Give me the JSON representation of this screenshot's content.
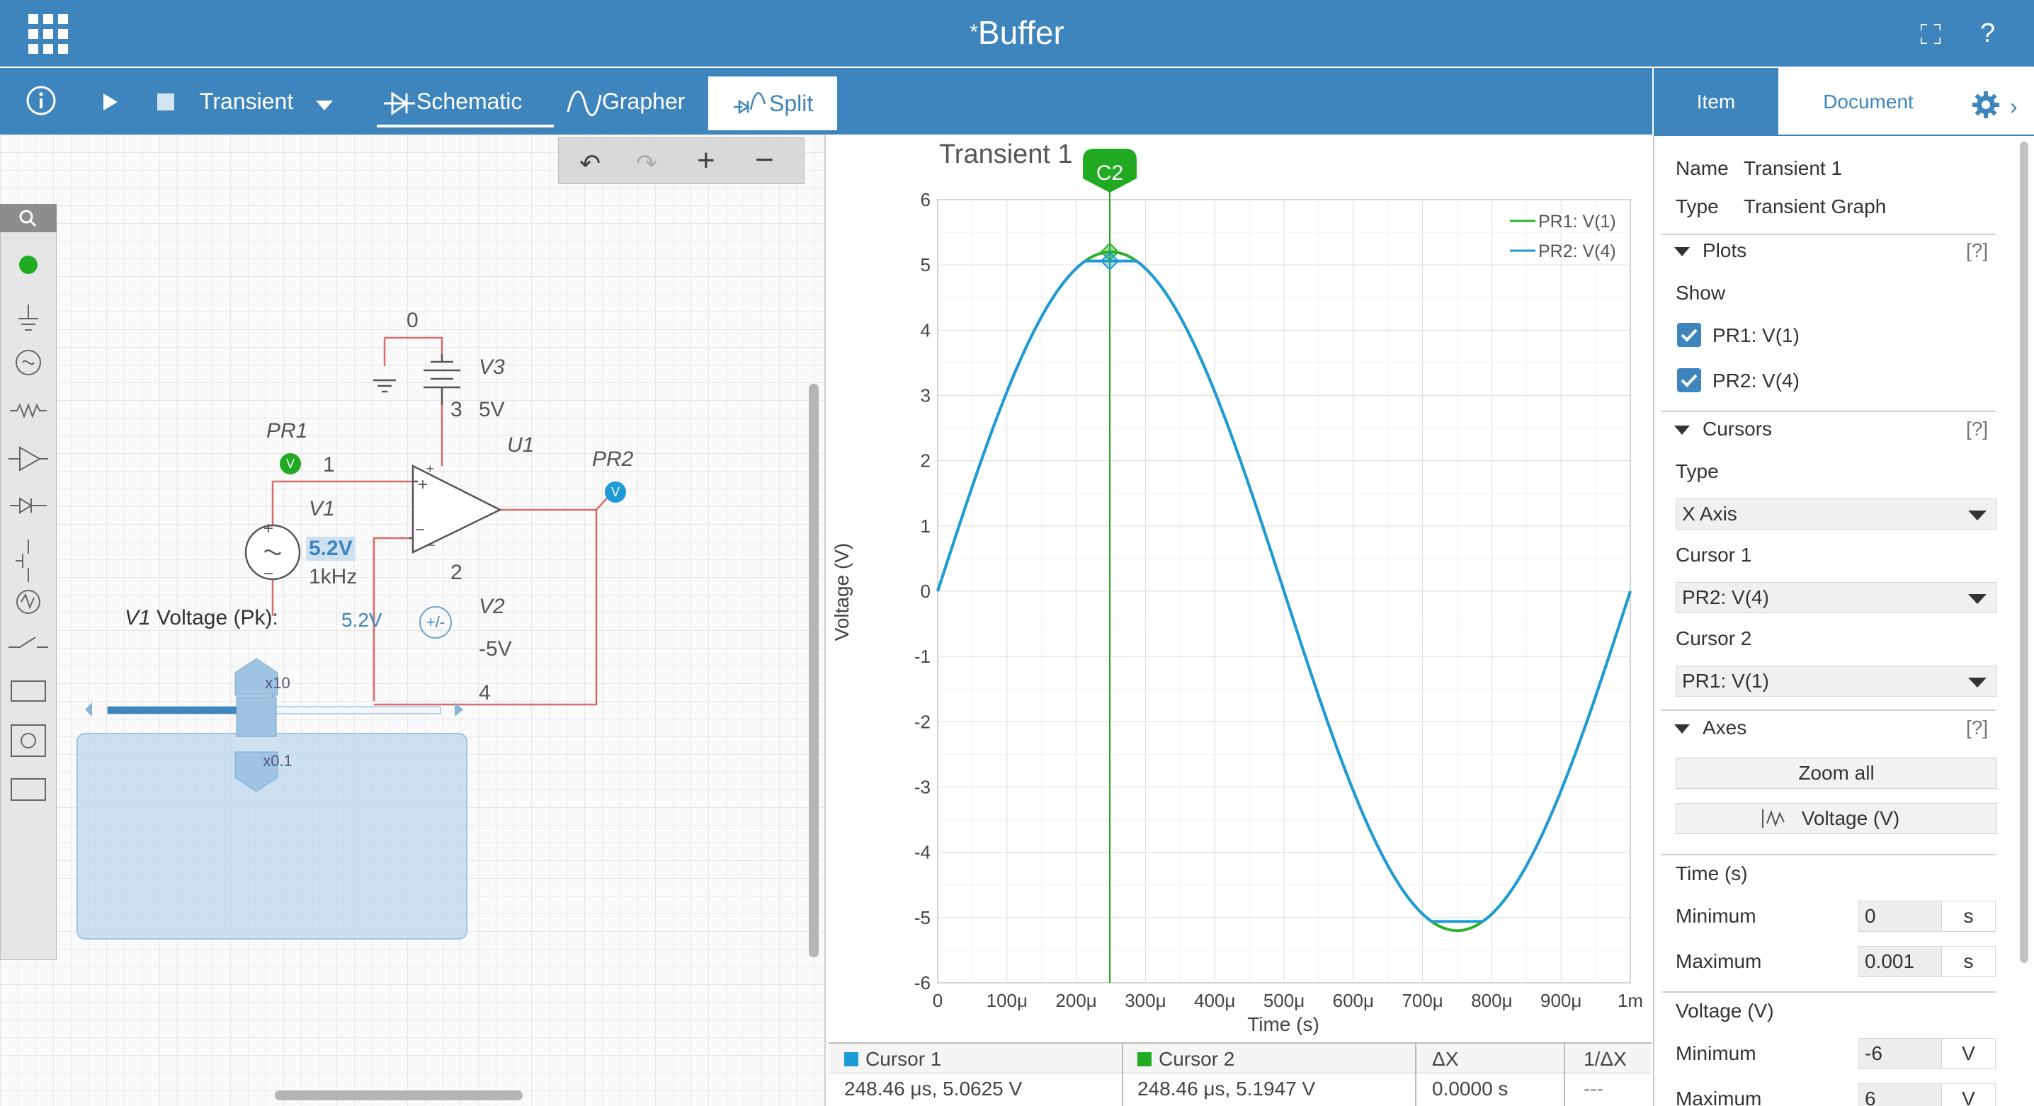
{
  "app": {
    "title": "Buffer",
    "modified_marker": "*"
  },
  "toolbar": {
    "mode_label": "Transient",
    "schematic_label": "Schematic",
    "grapher_label": "Grapher",
    "split_label": "Split"
  },
  "schematic": {
    "net_labels": [
      "0",
      "1",
      "2",
      "3",
      "4"
    ],
    "parts": {
      "v3": "V3",
      "v3_value": "5V",
      "u1": "U1",
      "pr1": "PR1",
      "pr2": "PR2",
      "v1": "V1",
      "v1_amp": "5.2V",
      "v1_freq": "1kHz",
      "v2": "V2",
      "v2_value": "-5V"
    },
    "probe_glyph": "V"
  },
  "slider": {
    "label_part": "V1",
    "label_text": "Voltage (Pk):",
    "value": "5.2V",
    "sign_button": "+/-",
    "x10": "x10",
    "x01": "x0.1",
    "level": 0.46
  },
  "chart_data": {
    "type": "line",
    "title": "Transient 1",
    "xlabel": "Time (s)",
    "ylabel": "Voltage (V)",
    "x_ticks": [
      "0",
      "100μ",
      "200μ",
      "300μ",
      "400μ",
      "500μ",
      "600μ",
      "700μ",
      "800μ",
      "900μ",
      "1m"
    ],
    "y_ticks": [
      "6",
      "5",
      "4",
      "3",
      "2",
      "1",
      "0",
      "-1",
      "-2",
      "-3",
      "-4",
      "-5",
      "-6"
    ],
    "xlim": [
      0,
      0.001
    ],
    "ylim": [
      -6,
      6
    ],
    "grid": true,
    "legend_position": "top-right",
    "series": [
      {
        "name": "PR1: V(1)",
        "color": "#2bb32b",
        "amplitude": 5.2,
        "frequency_hz": 1000
      },
      {
        "name": "PR2: V(4)",
        "color": "#1e9ad6",
        "amplitude": 5.2,
        "frequency_hz": 1000,
        "clip": 5.06
      }
    ],
    "cursor": {
      "label": "C2",
      "x": 0.00024846,
      "color": "#22aa22"
    }
  },
  "cursor_table": {
    "headers": [
      "Cursor 1",
      "Cursor 2",
      "ΔX",
      "1/ΔX"
    ],
    "values": [
      "248.46 μs, 5.0625 V",
      "248.46 μs, 5.1947 V",
      "0.0000 s",
      "---"
    ]
  },
  "panel": {
    "tabs": [
      "Item",
      "Document"
    ],
    "name_label": "Name",
    "name_value": "Transient 1",
    "type_label": "Type",
    "type_value": "Transient Graph",
    "plots_header": "Plots",
    "help": "[?]",
    "show_label": "Show",
    "plot_items": [
      "PR1: V(1)",
      "PR2: V(4)"
    ],
    "cursors_header": "Cursors",
    "cursor_type_label": "Type",
    "cursor_type_value": "X Axis",
    "cursor1_label": "Cursor 1",
    "cursor1_value": "PR2: V(4)",
    "cursor2_label": "Cursor 2",
    "cursor2_value": "PR1: V(1)",
    "axes_header": "Axes",
    "zoom_all": "Zoom all",
    "voltage_button": "Voltage (V)",
    "time_section": "Time (s)",
    "min_label": "Minimum",
    "max_label": "Maximum",
    "time_min": "0",
    "time_max": "0.001",
    "time_unit": "s",
    "voltage_section": "Voltage (V)",
    "volt_min": "-6",
    "volt_max": "6",
    "volt_unit": "V"
  }
}
